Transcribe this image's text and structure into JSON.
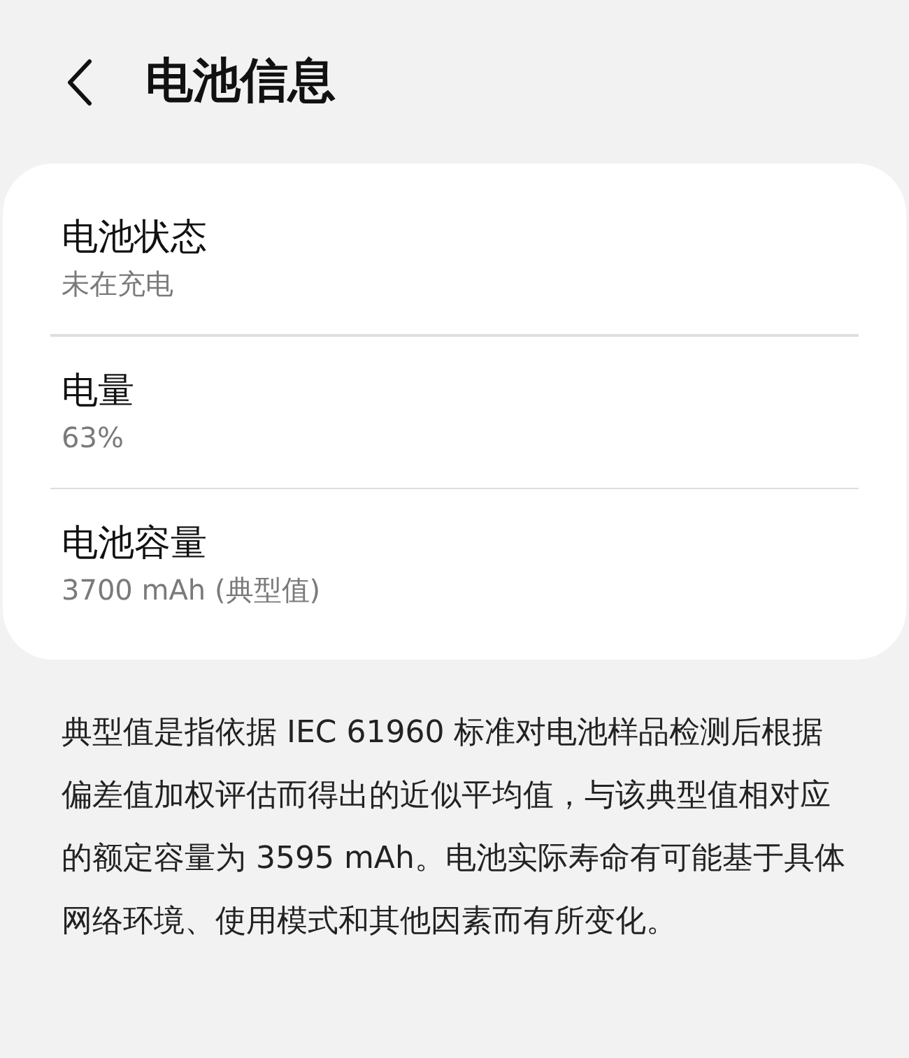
{
  "header": {
    "title": "电池信息"
  },
  "items": [
    {
      "title": "电池状态",
      "value": "未在充电"
    },
    {
      "title": "电量",
      "value": "63%"
    },
    {
      "title": "电池容量",
      "value": "3700 mAh (典型值)"
    }
  ],
  "note": "典型值是指依据 IEC 61960 标准对电池样品检测后根据偏差值加权评估而得出的近似平均值，与该典型值相对应的额定容量为 3595 mAh。电池实际寿命有可能基于具体网络环境、使用模式和其他因素而有所变化。"
}
